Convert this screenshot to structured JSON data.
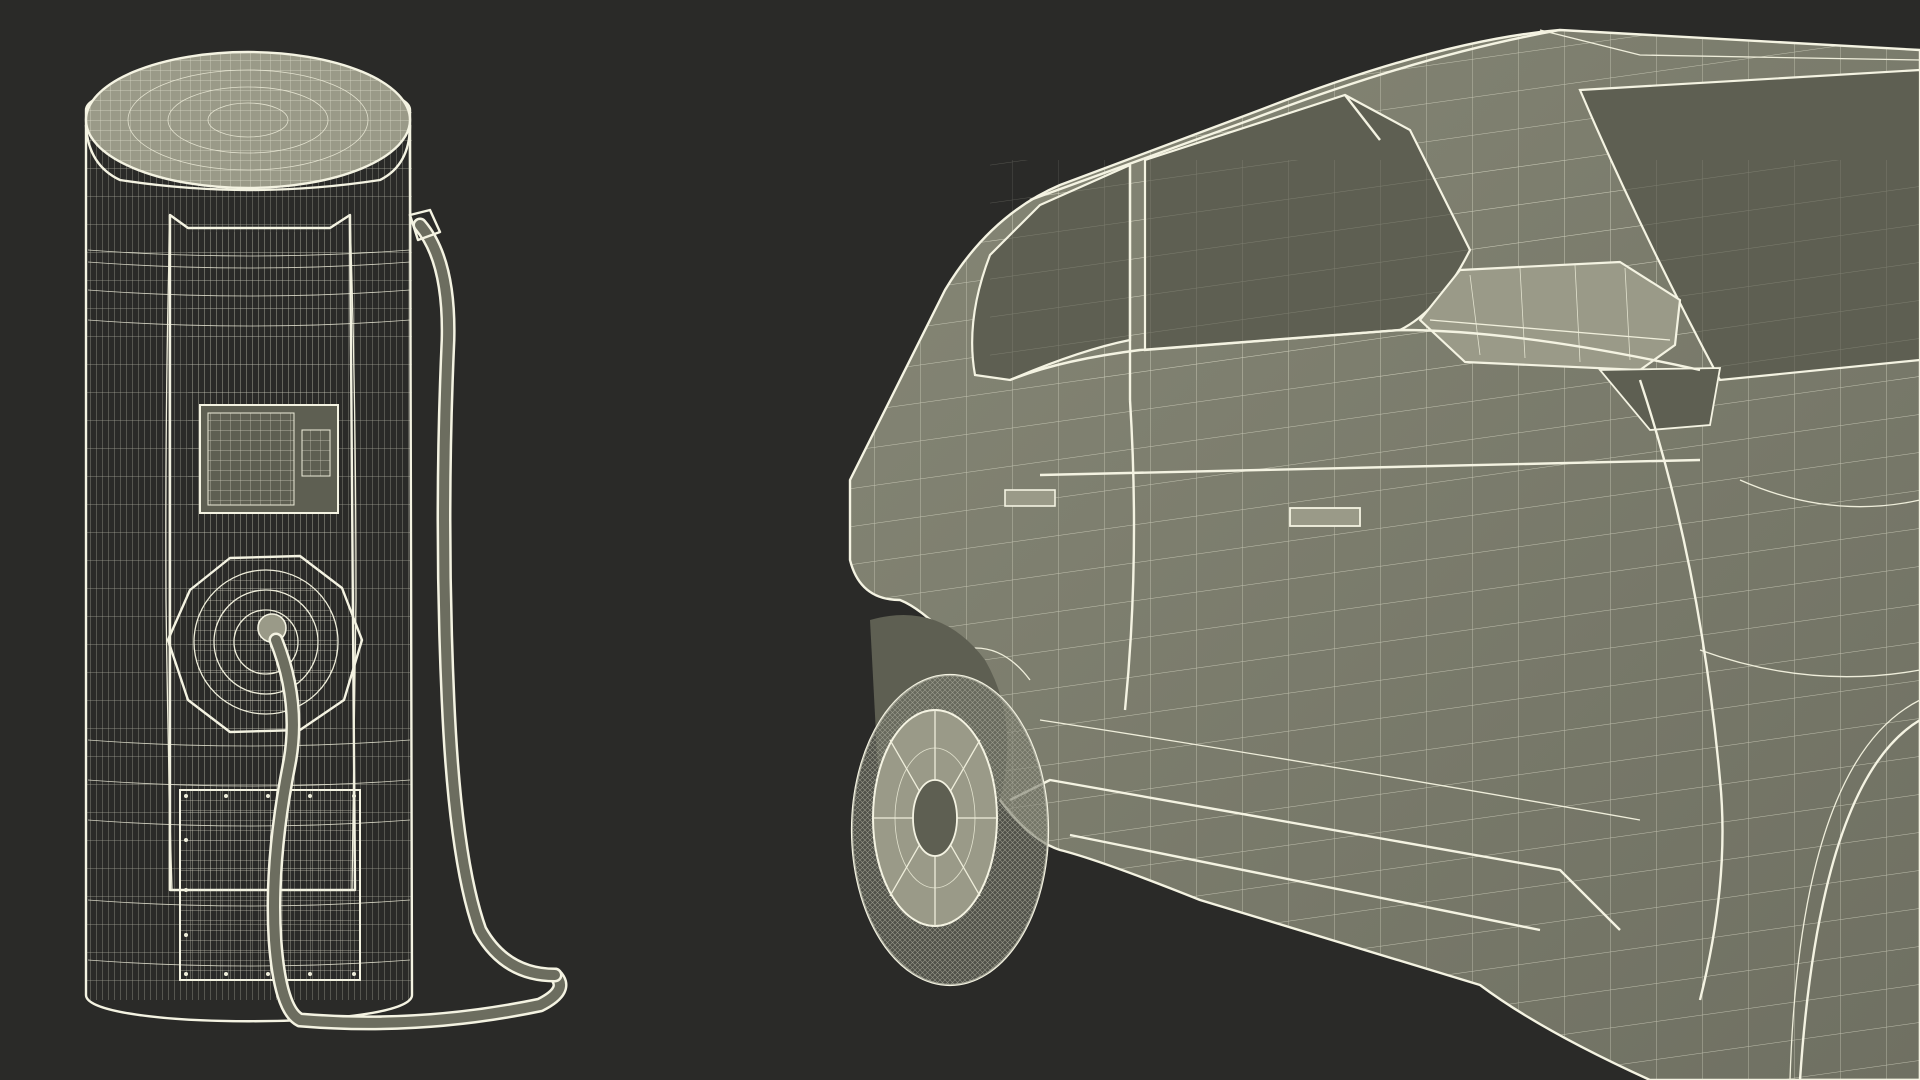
{
  "scene": {
    "background": "#2a2a28",
    "wire_color": "#efeedb",
    "surface_color": "#7d7e6e",
    "objects": [
      {
        "name": "ev-charging-station",
        "description_icon": "charger-icon"
      },
      {
        "name": "electric-car",
        "description_icon": "car-icon"
      }
    ]
  }
}
